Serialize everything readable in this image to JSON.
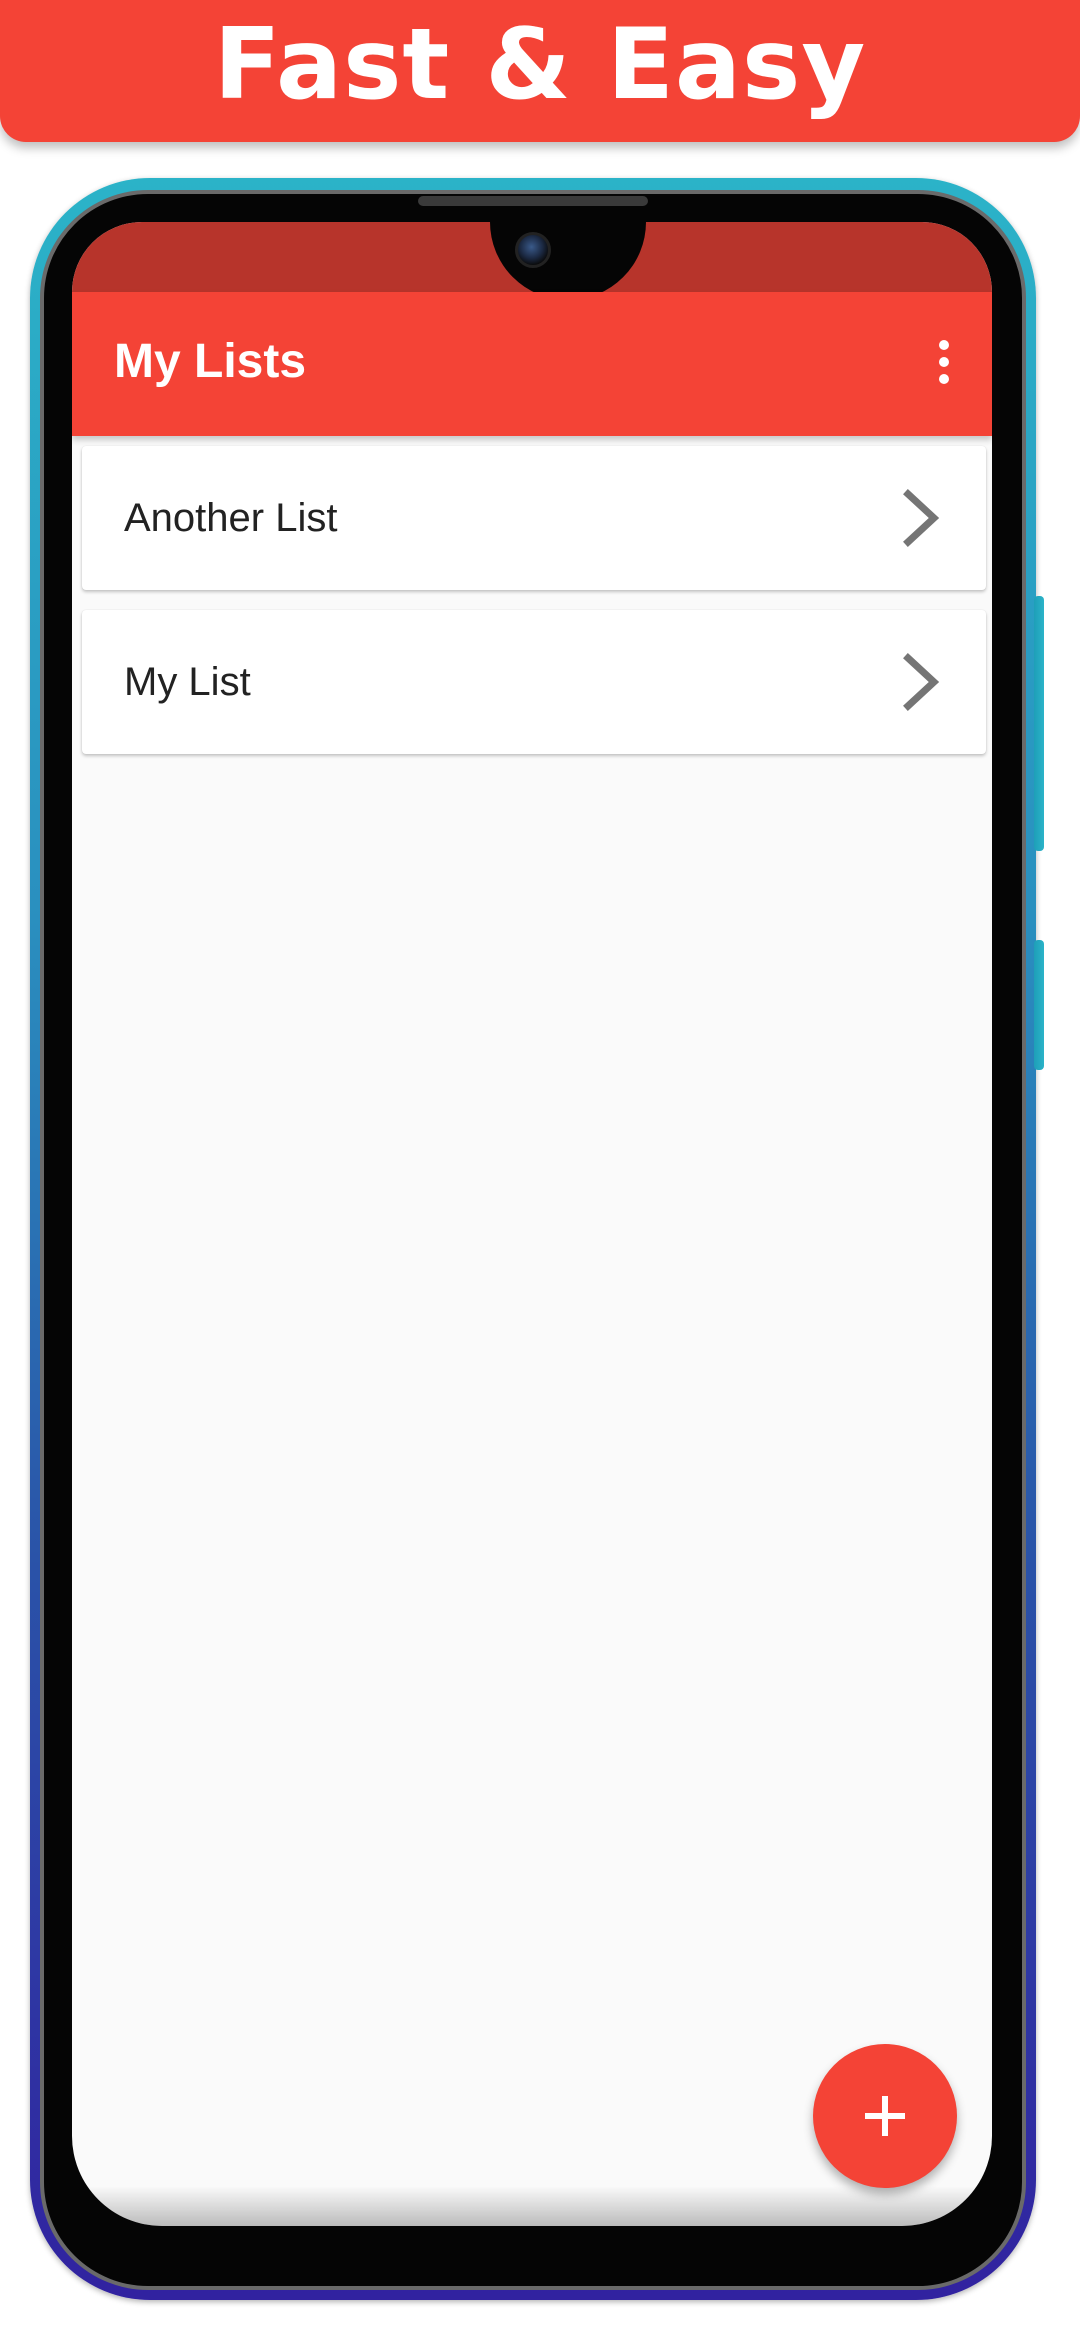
{
  "banner": {
    "title": "Fast & Easy"
  },
  "app_bar": {
    "title": "My Lists",
    "menu_icon": "more-vert-icon"
  },
  "lists": [
    {
      "label": "Another List",
      "icon": "chevron-right-icon"
    },
    {
      "label": "My List",
      "icon": "chevron-right-icon"
    }
  ],
  "fab": {
    "icon": "add-icon"
  },
  "colors": {
    "accent": "#f44336",
    "status_bar": "#b7342b",
    "background": "#fafafa",
    "card": "#ffffff",
    "chevron": "#757575"
  }
}
